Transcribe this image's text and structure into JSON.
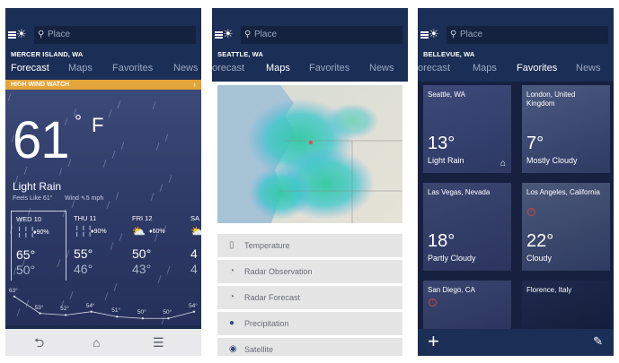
{
  "colors": {
    "header": "#1b2e56",
    "alert": "#e3a43a",
    "tile": "#3a4670"
  },
  "screens": [
    {
      "search_placeholder": "Place",
      "location": "MERCER ISLAND, WA",
      "tabs": [
        "Forecast",
        "Maps",
        "Favorites",
        "News"
      ],
      "active_tab": "Forecast",
      "alert": {
        "label": "HIGH WIND WATCH",
        "chevron_icon": "chevron-right-icon"
      },
      "current": {
        "temp": "61",
        "degree": "°",
        "unit": "F",
        "condition": "Light Rain",
        "feels_like": "Feels Like 61°",
        "wind": "Wind ⇖5 mph"
      },
      "forecast": [
        {
          "day": "WED 10",
          "icon": "rain-icon",
          "precip": "♦90%",
          "hi": "65°",
          "lo": "50°"
        },
        {
          "day": "THU 11",
          "icon": "rain-icon",
          "precip": "♦90%",
          "hi": "55°",
          "lo": "46°"
        },
        {
          "day": "FRI 12",
          "icon": "partly-cloudy-icon",
          "precip": "♦60%",
          "hi": "50°",
          "lo": "43°"
        },
        {
          "day": "SA",
          "icon": "partly-cloudy-icon",
          "precip": "",
          "hi": "4",
          "lo": "4"
        }
      ],
      "hourly_graph": {
        "labels": [
          "63°",
          "53°",
          "52°",
          "54°",
          "51°",
          "50°",
          "50°",
          "54°"
        ],
        "values": [
          63,
          53,
          52,
          54,
          51,
          50,
          50,
          54
        ]
      },
      "nav_buttons": [
        "back-icon",
        "home-icon",
        "menu-icon"
      ]
    },
    {
      "search_placeholder": "Place",
      "location": "SEATTLE, WA",
      "tabs": [
        "orecast",
        "Maps",
        "Favorites",
        "News"
      ],
      "active_tab": "Maps",
      "map_layers": [
        {
          "icon": "thermometer-icon",
          "label": "Temperature"
        },
        {
          "icon": "radar-icon",
          "label": "Radar Observation"
        },
        {
          "icon": "radar-icon",
          "label": "Radar Forecast"
        },
        {
          "icon": "raindrop-icon",
          "label": "Precipitation"
        },
        {
          "icon": "satellite-icon",
          "label": "Satellite"
        }
      ]
    },
    {
      "search_placeholder": "Place",
      "location": "BELLEVUE, WA",
      "tabs": [
        "orecast",
        "Maps",
        "Favorites",
        "News"
      ],
      "active_tab": "Favorites",
      "favorites": [
        {
          "location": "Seattle, WA",
          "temp": "13°",
          "condition": "Light Rain",
          "home": true,
          "alert": false
        },
        {
          "location": "London, United Kingdom",
          "temp": "7°",
          "condition": "Mostly Cloudy",
          "home": false,
          "alert": false
        },
        {
          "location": "Las Vegas, Nevada",
          "temp": "18°",
          "condition": "Partly Cloudy",
          "home": false,
          "alert": false
        },
        {
          "location": "Los Angeles, California",
          "temp": "22°",
          "condition": "Cloudy",
          "home": false,
          "alert": true
        },
        {
          "location": "San Diego, CA",
          "temp": "",
          "condition": "",
          "home": false,
          "alert": true
        },
        {
          "location": "Florence, Italy",
          "temp": "",
          "condition": "",
          "home": false,
          "alert": false
        }
      ],
      "bottom_actions": [
        "add-icon",
        "edit-icon"
      ]
    }
  ]
}
